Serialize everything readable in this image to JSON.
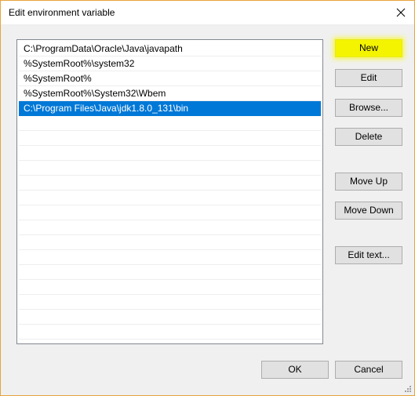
{
  "window": {
    "title": "Edit environment variable",
    "close_glyph": "✕"
  },
  "list": {
    "items": [
      "C:\\ProgramData\\Oracle\\Java\\javapath",
      "%SystemRoot%\\system32",
      "%SystemRoot%",
      "%SystemRoot%\\System32\\Wbem",
      "C:\\Program Files\\Java\\jdk1.8.0_131\\bin"
    ],
    "selected_index": 4
  },
  "side_buttons": {
    "new": "New",
    "edit": "Edit",
    "browse": "Browse...",
    "delete": "Delete",
    "move_up": "Move Up",
    "move_down": "Move Down",
    "edit_text": "Edit text..."
  },
  "footer": {
    "ok": "OK",
    "cancel": "Cancel"
  },
  "colors": {
    "selection": "#0078d7",
    "highlight": "#f4f400",
    "frame": "#e8a33d"
  },
  "icons": {
    "close": "close-icon",
    "resize": "resize-grip-icon"
  }
}
